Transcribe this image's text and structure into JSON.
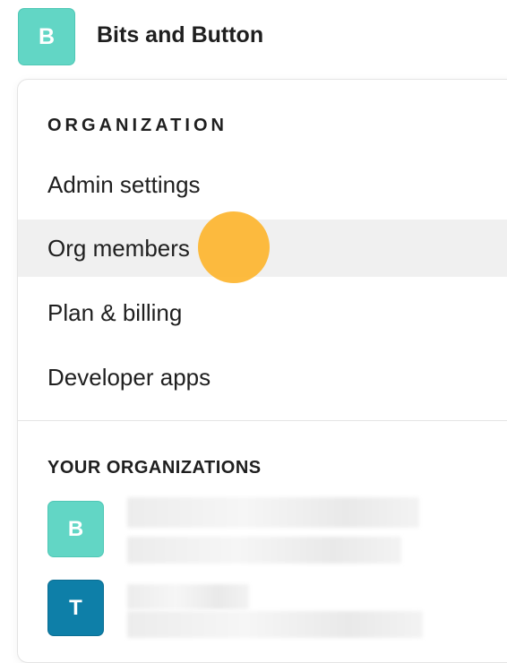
{
  "header": {
    "avatar_letter": "B",
    "org_name": "Bits and Button"
  },
  "menu": {
    "section_organization": "ORGANIZATION",
    "items": [
      {
        "label": "Admin settings"
      },
      {
        "label": "Org members"
      },
      {
        "label": "Plan & billing"
      },
      {
        "label": "Developer apps"
      }
    ],
    "section_your_orgs": "YOUR ORGANIZATIONS",
    "orgs": [
      {
        "avatar_letter": "B"
      },
      {
        "avatar_letter": "T"
      }
    ]
  },
  "colors": {
    "teal_avatar": "#62d6c5",
    "blue_avatar": "#0e7fa8",
    "active_row": "#f0f0f0",
    "click_indicator": "#fdb52f"
  }
}
